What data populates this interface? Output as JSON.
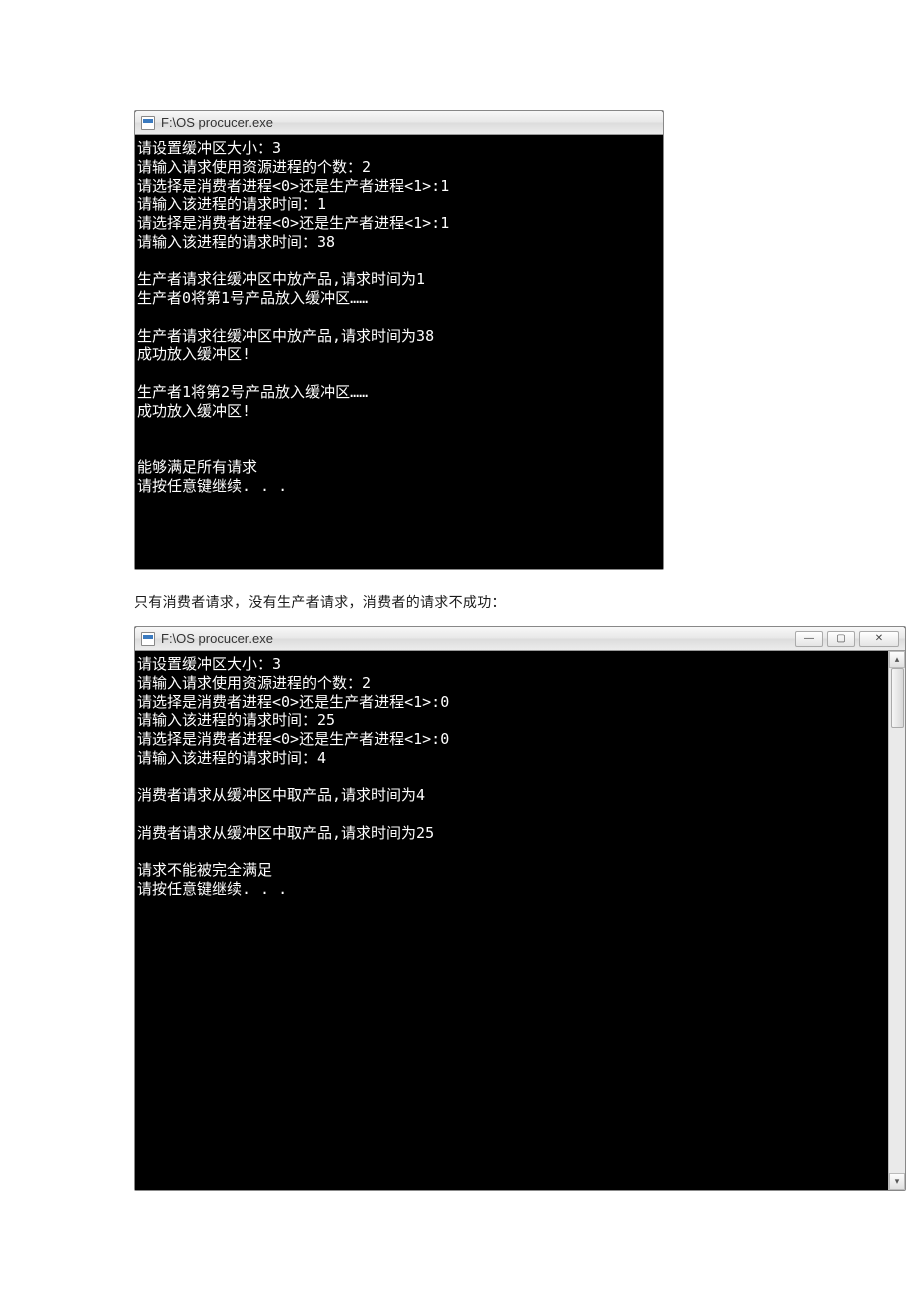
{
  "window1": {
    "title": "F:\\OS procucer.exe",
    "lines": [
      "请设置缓冲区大小：3",
      "请输入请求使用资源进程的个数：2",
      "请选择是消费者进程<0>还是生产者进程<1>:1",
      "请输入该进程的请求时间：1",
      "请选择是消费者进程<0>还是生产者进程<1>:1",
      "请输入该进程的请求时间：38",
      "",
      "生产者请求往缓冲区中放产品,请求时间为1",
      "生产者0将第1号产品放入缓冲区……",
      "",
      "生产者请求往缓冲区中放产品,请求时间为38",
      "成功放入缓冲区!",
      "",
      "生产者1将第2号产品放入缓冲区……",
      "成功放入缓冲区!",
      "",
      "",
      "能够满足所有请求",
      "请按任意键继续. . ."
    ]
  },
  "caption": "只有消费者请求，没有生产者请求，消费者的请求不成功：",
  "window2": {
    "title": "F:\\OS procucer.exe",
    "lines": [
      "请设置缓冲区大小：3",
      "请输入请求使用资源进程的个数：2",
      "请选择是消费者进程<0>还是生产者进程<1>:0",
      "请输入该进程的请求时间：25",
      "请选择是消费者进程<0>还是生产者进程<1>:0",
      "请输入该进程的请求时间：4",
      "",
      "消费者请求从缓冲区中取产品,请求时间为4",
      "",
      "消费者请求从缓冲区中取产品,请求时间为25",
      "",
      "请求不能被完全满足",
      "请按任意键继续. . ."
    ],
    "controls": {
      "minimize": "—",
      "maximize": "▢",
      "close": "✕"
    },
    "scroll": {
      "up": "▴",
      "down": "▾"
    }
  }
}
